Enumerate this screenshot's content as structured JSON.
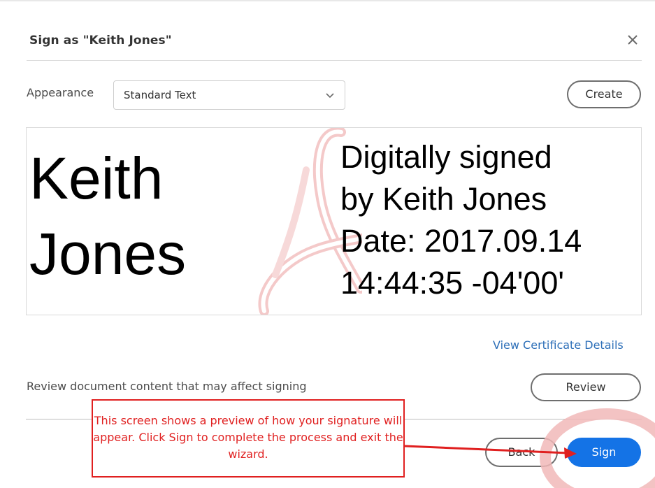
{
  "dialog": {
    "title": "Sign as \"Keith Jones\"",
    "close_icon": "close-icon"
  },
  "appearance": {
    "label": "Appearance",
    "selected": "Standard Text",
    "create_label": "Create"
  },
  "preview": {
    "name_line1": "Keith",
    "name_line2": "Jones",
    "details": [
      "Digitally signed",
      "by Keith Jones",
      "Date: 2017.09.14",
      "14:44:35 -04'00'"
    ]
  },
  "links": {
    "view_certificate": "View Certificate Details"
  },
  "review": {
    "text": "Review document content that may affect signing",
    "button_label": "Review"
  },
  "footer": {
    "back_label": "Back",
    "sign_label": "Sign"
  },
  "annotation": {
    "callout_text": "This screen shows a preview of how your signature will appear. Click Sign to complete the process and exit the wizard."
  },
  "colors": {
    "accent": "#1473e6",
    "link": "#2d6fb8",
    "annotation": "#e02020"
  }
}
